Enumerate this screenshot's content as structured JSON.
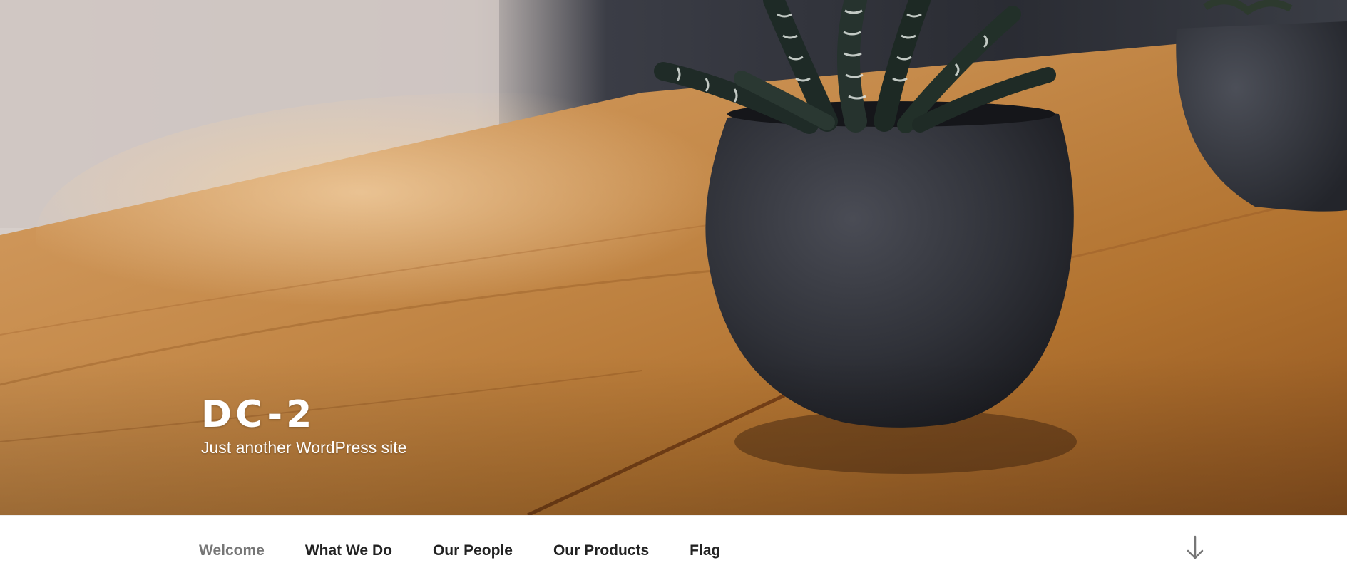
{
  "site": {
    "title": "DC-2",
    "description": "Just another WordPress site"
  },
  "nav": {
    "items": [
      {
        "label": "Welcome",
        "current": true
      },
      {
        "label": "What We Do",
        "current": false
      },
      {
        "label": "Our People",
        "current": false
      },
      {
        "label": "Our Products",
        "current": false
      },
      {
        "label": "Flag",
        "current": false
      }
    ],
    "scroll_icon": "arrow-down-icon"
  },
  "header_image": {
    "subject": "succulent in dark pot on wooden table",
    "colors": {
      "wood": "#b27536",
      "pot": "#2f3036",
      "plant": "#1f2a26",
      "wall": "#cfc7c4"
    }
  },
  "colors": {
    "menu_text": "#222222",
    "menu_current": "#767676",
    "nav_background": "#ffffff",
    "title_text": "#ffffff"
  }
}
